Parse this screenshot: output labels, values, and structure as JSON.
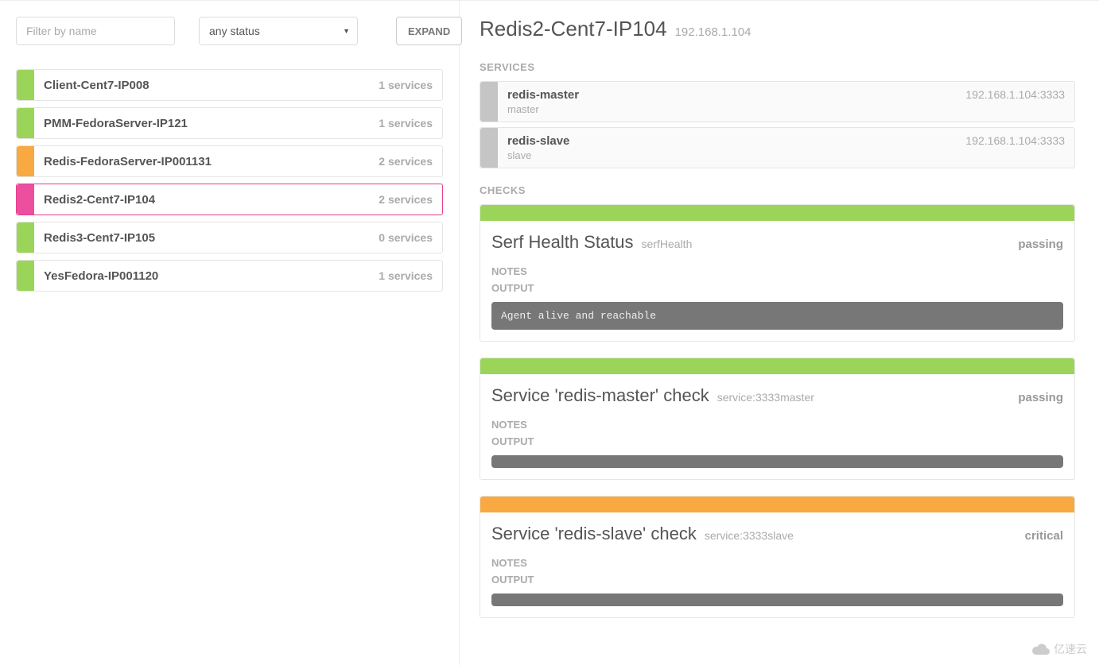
{
  "filter": {
    "placeholder": "Filter by name",
    "status_label": "any status",
    "expand_label": "EXPAND"
  },
  "nodes": [
    {
      "name": "Client-Cent7-IP008",
      "services": "1 services",
      "status": "green",
      "selected": false
    },
    {
      "name": "PMM-FedoraServer-IP121",
      "services": "1 services",
      "status": "green",
      "selected": false
    },
    {
      "name": "Redis-FedoraServer-IP001131",
      "services": "2 services",
      "status": "orange",
      "selected": false
    },
    {
      "name": "Redis2-Cent7-IP104",
      "services": "2 services",
      "status": "pink",
      "selected": true
    },
    {
      "name": "Redis3-Cent7-IP105",
      "services": "0 services",
      "status": "green",
      "selected": false
    },
    {
      "name": "YesFedora-IP001120",
      "services": "1 services",
      "status": "green",
      "selected": false
    }
  ],
  "detail": {
    "title": "Redis2-Cent7-IP104",
    "ip": "192.168.1.104",
    "services_label": "SERVICES",
    "checks_label": "CHECKS",
    "notes_label": "NOTES",
    "output_label": "OUTPUT",
    "services": [
      {
        "name": "redis-master",
        "tag": "master",
        "addr": "192.168.1.104:3333"
      },
      {
        "name": "redis-slave",
        "tag": "slave",
        "addr": "192.168.1.104:3333"
      }
    ],
    "checks": [
      {
        "title": "Serf Health Status",
        "id": "serfHealth",
        "status": "passing",
        "status_class": "passing",
        "output": "Agent alive and reachable"
      },
      {
        "title": "Service 'redis-master' check",
        "id": "service:3333master",
        "status": "passing",
        "status_class": "passing",
        "output": ""
      },
      {
        "title": "Service 'redis-slave' check",
        "id": "service:3333slave",
        "status": "critical",
        "status_class": "critical",
        "output": ""
      }
    ]
  },
  "watermark": "亿速云"
}
